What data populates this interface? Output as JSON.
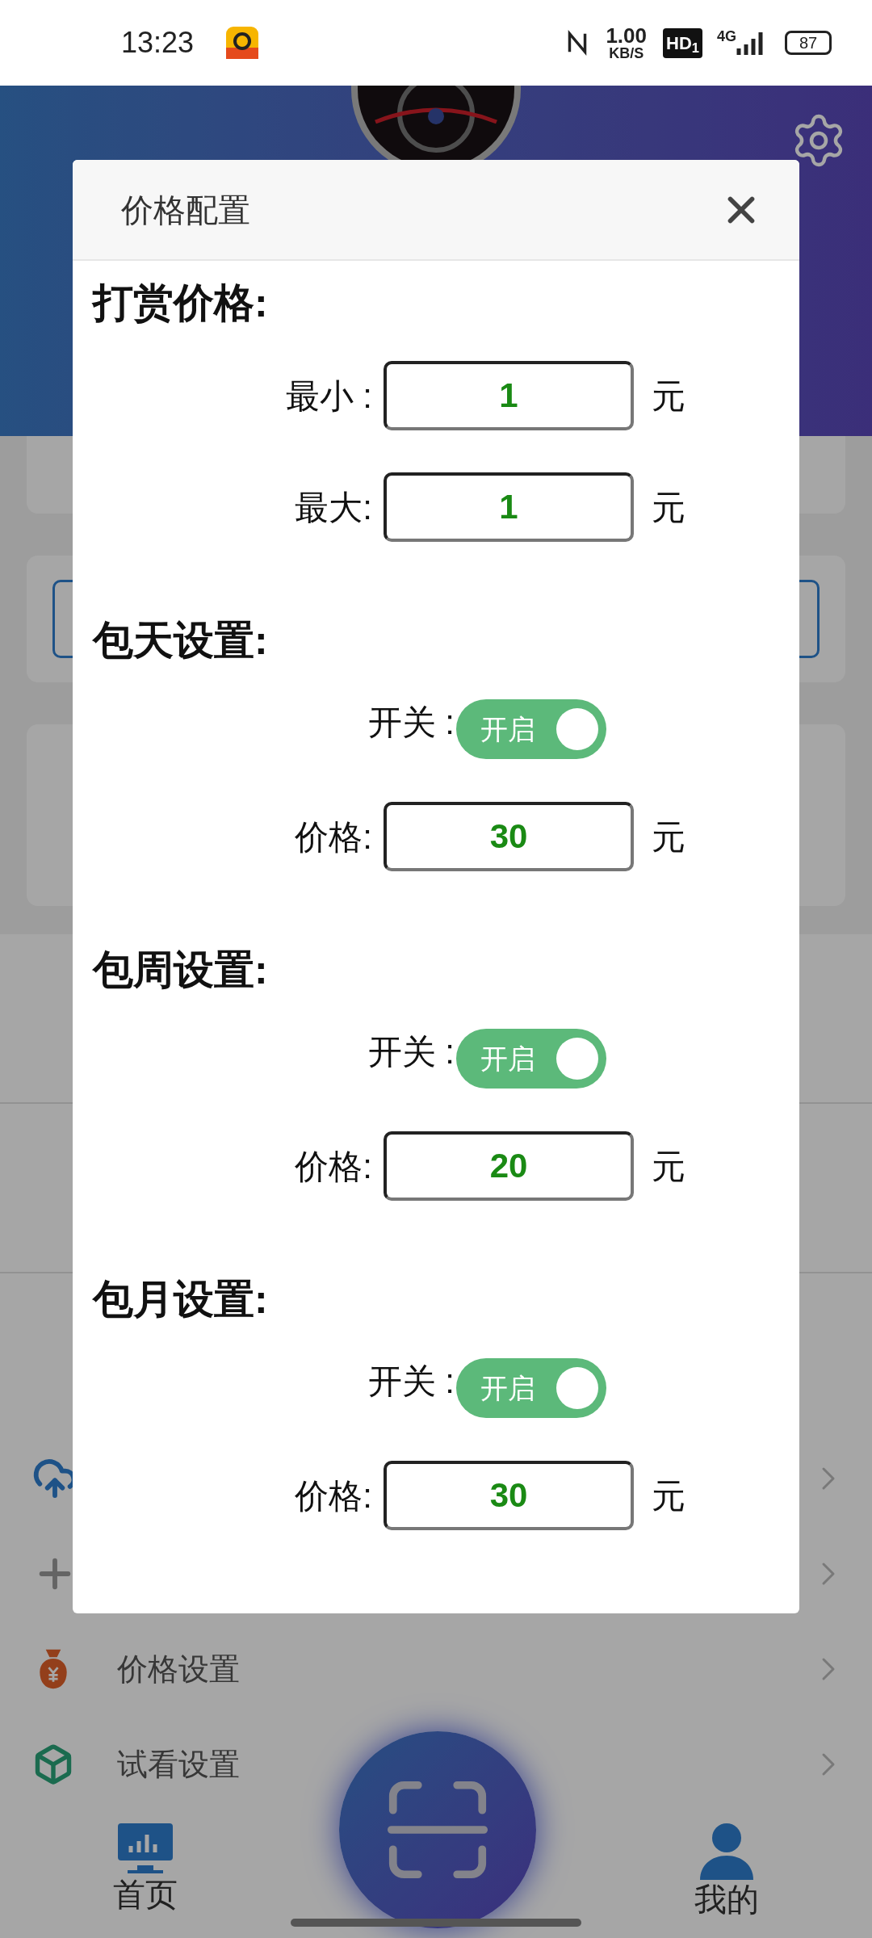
{
  "status_bar": {
    "time": "13:23",
    "speed_value": "1.00",
    "speed_unit": "KB/S",
    "hd_badge": "HD$_{1}$",
    "network": "4G",
    "battery": "87"
  },
  "menu": [
    {
      "kind": "upload"
    },
    {
      "kind": "add"
    },
    {
      "kind": "price",
      "label": "价格设置"
    },
    {
      "kind": "trial",
      "label": "试看设置"
    }
  ],
  "bottom_nav": [
    {
      "kind": "home",
      "label": "首页"
    },
    {
      "kind": "scan"
    },
    {
      "kind": "profile",
      "label": "我的"
    }
  ],
  "dialog": {
    "title": "价格配置",
    "sections": [
      {
        "heading": "打赏价格:",
        "rows": [
          {
            "kind": "input",
            "label": "最小 :",
            "value": "1",
            "unit": "元"
          },
          {
            "kind": "input",
            "label": "最大:",
            "value": "1",
            "unit": "元"
          }
        ]
      },
      {
        "heading": "包天设置:",
        "rows": [
          {
            "kind": "switch",
            "label": "开关 :",
            "on": true,
            "text": "开启"
          },
          {
            "kind": "input",
            "label": "价格:",
            "value": "30",
            "unit": "元"
          }
        ]
      },
      {
        "heading": "包周设置:",
        "rows": [
          {
            "kind": "switch",
            "label": "开关 :",
            "on": true,
            "text": "开启"
          },
          {
            "kind": "input",
            "label": "价格:",
            "value": "20",
            "unit": "元"
          }
        ]
      },
      {
        "heading": "包月设置:",
        "rows": [
          {
            "kind": "switch",
            "label": "开关 :",
            "on": true,
            "text": "开启"
          },
          {
            "kind": "input",
            "label": "价格:",
            "value": "30",
            "unit": "元"
          }
        ]
      }
    ]
  }
}
